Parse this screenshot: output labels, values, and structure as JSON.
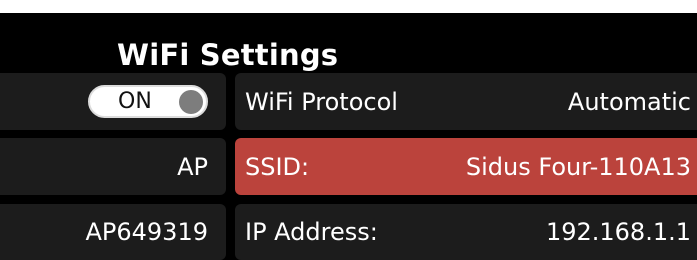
{
  "header": {
    "title": "WiFi Settings"
  },
  "left_column": {
    "wifi_toggle": {
      "label": "ON",
      "state": "on"
    },
    "mode_value": "AP",
    "ap_name_value": "AP649319"
  },
  "right_column": {
    "protocol": {
      "label": "WiFi Protocol",
      "value": "Automatic"
    },
    "ssid": {
      "label": "SSID:",
      "value": "Sidus Four-110A13",
      "selected": true
    },
    "ip_address": {
      "label": "IP Address:",
      "value": "192.168.1.1"
    }
  },
  "colors": {
    "background": "#000000",
    "cell": "#1c1c1c",
    "selected": "#bb433c",
    "text": "#ffffff"
  }
}
